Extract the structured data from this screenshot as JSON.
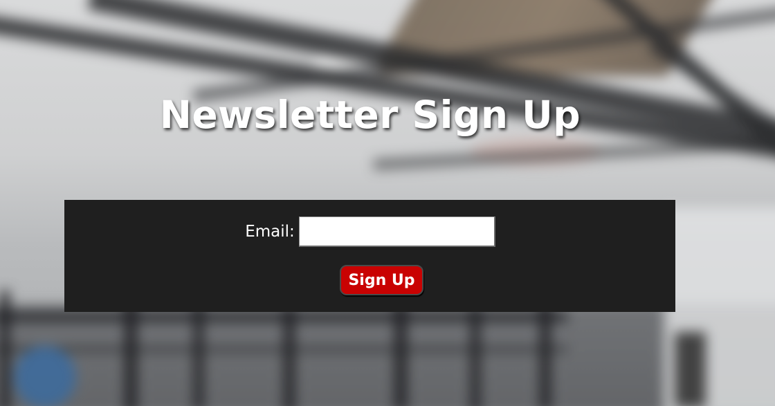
{
  "page": {
    "title": "Newsletter Sign Up"
  },
  "form": {
    "email_label": "Email:",
    "email_value": "",
    "submit_label": "Sign Up"
  },
  "colors": {
    "panel_background": "#1f1f1f",
    "button_background": "#c90202",
    "title_text": "#ffffff"
  }
}
